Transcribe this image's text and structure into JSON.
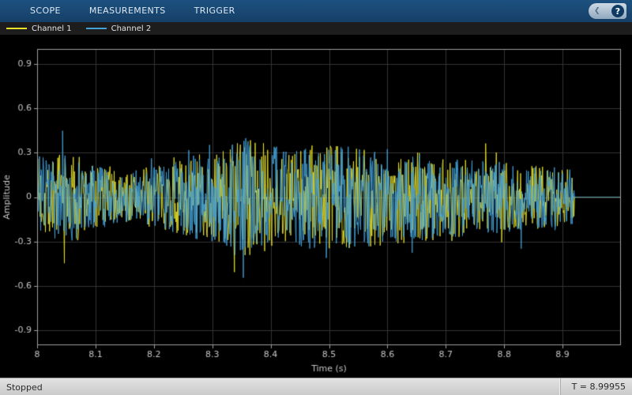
{
  "toolbar": {
    "tabs": [
      {
        "label": "SCOPE"
      },
      {
        "label": "MEASUREMENTS"
      },
      {
        "label": "TRIGGER"
      }
    ],
    "help_label": "?",
    "help_chevron": "❮"
  },
  "legend": {
    "items": [
      {
        "label": "Channel 1",
        "color": "#e8e22b"
      },
      {
        "label": "Channel 2",
        "color": "#45a2d9"
      }
    ]
  },
  "chart_data": {
    "type": "line",
    "title": "",
    "xlabel": "Time (s)",
    "ylabel": "Amplitude",
    "xlim": [
      8,
      9
    ],
    "ylim": [
      -1,
      1
    ],
    "x_ticks": [
      8,
      8.1,
      8.2,
      8.3,
      8.4,
      8.5,
      8.6,
      8.7,
      8.8,
      8.9
    ],
    "x_tick_labels": [
      "8",
      "8.1",
      "8.2",
      "8.3",
      "8.4",
      "8.5",
      "8.6",
      "8.7",
      "8.8",
      "8.9"
    ],
    "y_ticks": [
      0.9,
      0.6,
      0.3,
      0,
      -0.3,
      -0.6,
      -0.9
    ],
    "y_tick_labels": [
      "0.9",
      "0.6",
      "0.3",
      "0",
      "-0.3",
      "-0.6",
      "-0.9"
    ],
    "grid": true,
    "legend_position": "top-left",
    "background": "#000000",
    "grid_color": "#333333",
    "axis_color": "#9e9e9e",
    "text_color": "#c4c4c4",
    "signal": {
      "description": "band-limited random noise on both channels from t=8.0 to t=8.92, flat 0 afterwards",
      "t_start": 8.0,
      "t_end": 8.92,
      "flat_value": 0,
      "envelope": [
        [
          8.0,
          0.27
        ],
        [
          8.06,
          0.3
        ],
        [
          8.14,
          0.17
        ],
        [
          8.22,
          0.22
        ],
        [
          8.3,
          0.32
        ],
        [
          8.36,
          0.4
        ],
        [
          8.42,
          0.33
        ],
        [
          8.5,
          0.36
        ],
        [
          8.58,
          0.34
        ],
        [
          8.66,
          0.3
        ],
        [
          8.74,
          0.26
        ],
        [
          8.82,
          0.23
        ],
        [
          8.92,
          0.19
        ]
      ],
      "spike_probability": 0.03,
      "spike_gain": 1.55,
      "series": [
        {
          "name": "Channel 1",
          "color": "#e8e22b",
          "seed": 7
        },
        {
          "name": "Channel 2",
          "color": "#45a2d9",
          "seed": 23
        }
      ]
    }
  },
  "status_bar": {
    "left": "Stopped",
    "right": "T = 8.99955"
  }
}
